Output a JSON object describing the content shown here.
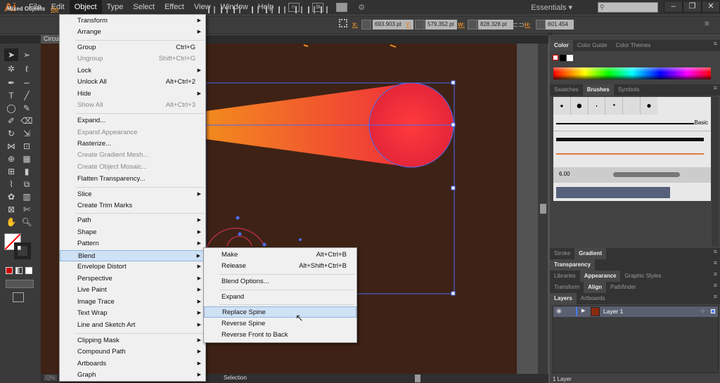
{
  "app": {
    "logo": "Ai",
    "menus": [
      "File",
      "Edit",
      "Object",
      "Type",
      "Select",
      "Effect",
      "View",
      "Window",
      "Help"
    ],
    "active_menu": "Object",
    "bridge": "Br",
    "stock": "St",
    "workspace": "Essentials",
    "search_placeholder": "",
    "window_buttons": [
      "–",
      "❐",
      "✕"
    ]
  },
  "control": {
    "selection_type": "Mixed Objects",
    "opacity_label": "Op",
    "x_label": "X:",
    "x": "693.903 pt",
    "y_label": "Y:",
    "y": "579.352 pt",
    "w_label": "W:",
    "w": "828.328 pt",
    "h_label": "H:",
    "h": "601.454 pt"
  },
  "document": {
    "tab": "Circul"
  },
  "object_menu": [
    {
      "label": "Transform",
      "submenu": true
    },
    {
      "label": "Arrange",
      "submenu": true
    },
    {
      "label": "Group",
      "shortcut": "Ctrl+G"
    },
    {
      "label": "Ungroup",
      "shortcut": "Shift+Ctrl+G",
      "disabled": true
    },
    {
      "label": "Lock",
      "submenu": true
    },
    {
      "label": "Unlock All",
      "shortcut": "Alt+Ctrl+2"
    },
    {
      "label": "Hide",
      "submenu": true
    },
    {
      "label": "Show All",
      "shortcut": "Alt+Ctrl+3",
      "disabled": true
    },
    {
      "label": "Expand..."
    },
    {
      "label": "Expand Appearance",
      "disabled": true
    },
    {
      "label": "Rasterize..."
    },
    {
      "label": "Create Gradient Mesh...",
      "disabled": true
    },
    {
      "label": "Create Object Mosaic...",
      "disabled": true
    },
    {
      "label": "Flatten Transparency..."
    },
    {
      "label": "Slice",
      "submenu": true
    },
    {
      "label": "Create Trim Marks"
    },
    {
      "label": "Path",
      "submenu": true
    },
    {
      "label": "Shape",
      "submenu": true
    },
    {
      "label": "Pattern",
      "submenu": true
    },
    {
      "label": "Blend",
      "submenu": true,
      "highlighted": true
    },
    {
      "label": "Envelope Distort",
      "submenu": true
    },
    {
      "label": "Perspective",
      "submenu": true
    },
    {
      "label": "Live Paint",
      "submenu": true
    },
    {
      "label": "Image Trace",
      "submenu": true
    },
    {
      "label": "Text Wrap",
      "submenu": true
    },
    {
      "label": "Line and Sketch Art",
      "submenu": true
    },
    {
      "label": "Clipping Mask",
      "submenu": true
    },
    {
      "label": "Compound Path",
      "submenu": true
    },
    {
      "label": "Artboards",
      "submenu": true
    },
    {
      "label": "Graph",
      "submenu": true
    }
  ],
  "blend_submenu": [
    {
      "label": "Make",
      "shortcut": "Alt+Ctrl+B"
    },
    {
      "label": "Release",
      "shortcut": "Alt+Shift+Ctrl+B"
    },
    {
      "label": "Blend Options..."
    },
    {
      "label": "Expand"
    },
    {
      "label": "Replace Spine",
      "highlighted": true
    },
    {
      "label": "Reverse Spine"
    },
    {
      "label": "Reverse Front to Back"
    }
  ],
  "panels": {
    "color_tabs": [
      "Color",
      "Color Guide",
      "Color Themes"
    ],
    "brush_tabs": [
      "Swatches",
      "Brushes",
      "Symbols"
    ],
    "brush_basic": "Basic",
    "brush_size": "6.00",
    "stroke_tabs": [
      "Stroke",
      "Gradient"
    ],
    "transparency_tabs": [
      "Transparency"
    ],
    "appearance_tabs": [
      "Libraries",
      "Appearance",
      "Graphic Styles"
    ],
    "align_tabs": [
      "Transform",
      "Align",
      "Pathfinder"
    ],
    "layers_tabs": [
      "Layers",
      "Artboards"
    ],
    "layer_name": "Layer 1",
    "layer_count": "1 Layer"
  },
  "status": {
    "tool": "Selection",
    "zoom": "Q%"
  },
  "colors": {
    "accent": "#e08a2a",
    "artboard": "#3e2216",
    "selection": "#4a6cf0"
  }
}
